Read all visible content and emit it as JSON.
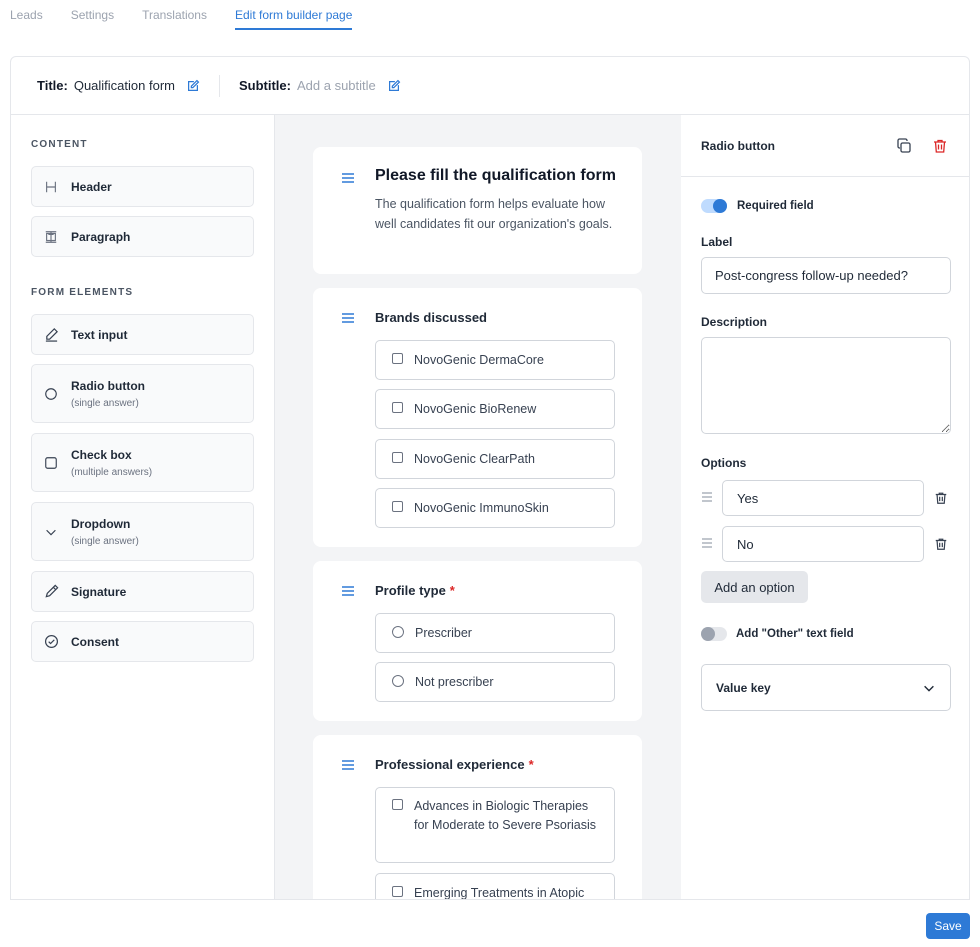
{
  "tabs": [
    {
      "label": "Leads"
    },
    {
      "label": "Settings"
    },
    {
      "label": "Translations"
    },
    {
      "label": "Edit form builder page"
    }
  ],
  "form_header": {
    "title_label": "Title:",
    "title_value": "Qualification form",
    "subtitle_label": "Subtitle:",
    "subtitle_placeholder": "Add a subtitle"
  },
  "palette": {
    "content_title": "CONTENT",
    "content_items": [
      {
        "label": "Header",
        "icon": "heading-icon"
      },
      {
        "label": "Paragraph",
        "icon": "paragraph-icon"
      }
    ],
    "elements_title": "FORM ELEMENTS",
    "element_items": [
      {
        "label": "Text input",
        "sub": "",
        "icon": "pencil-icon"
      },
      {
        "label": "Radio button",
        "sub": "(single answer)",
        "icon": "radio-icon"
      },
      {
        "label": "Check box",
        "sub": "(multiple answers)",
        "icon": "checkbox-icon"
      },
      {
        "label": "Dropdown",
        "sub": "(single answer)",
        "icon": "chevron-down-icon"
      },
      {
        "label": "Signature",
        "sub": "",
        "icon": "signature-icon"
      },
      {
        "label": "Consent",
        "sub": "",
        "icon": "check-circle-icon"
      }
    ]
  },
  "canvas": {
    "header_card": {
      "title": "Please fill the qualification form",
      "text": "The qualification form helps evaluate how well candidates fit our organization's goals."
    },
    "questions": [
      {
        "title": "Brands discussed",
        "required": false,
        "type": "checkbox",
        "options": [
          "NovoGenic DermaCore",
          "NovoGenic BioRenew",
          "NovoGenic ClearPath",
          "NovoGenic ImmunoSkin"
        ]
      },
      {
        "title": "Profile type",
        "required": true,
        "type": "radio",
        "options": [
          "Prescriber",
          "Not prescriber"
        ]
      },
      {
        "title": "Professional experience",
        "required": true,
        "type": "checkbox",
        "options": [
          "Advances in Biologic Therapies for Moderate to Severe Psoriasis",
          "Emerging Treatments in Atopic"
        ]
      }
    ],
    "required_mark": "*"
  },
  "properties": {
    "title": "Radio button",
    "required_label": "Required field",
    "required_on": true,
    "label_title": "Label",
    "label_value": "Post-congress follow-up needed?",
    "description_title": "Description",
    "description_value": "",
    "options_title": "Options",
    "options": [
      "Yes",
      "No"
    ],
    "add_option_label": "Add an option",
    "other_label": "Add \"Other\" text field",
    "other_on": false,
    "value_key_label": "Value key"
  },
  "save_label": "Save",
  "colors": {
    "accent": "#2e7ad6",
    "danger": "#dc2626",
    "canvas_bg": "#f3f4f6"
  }
}
